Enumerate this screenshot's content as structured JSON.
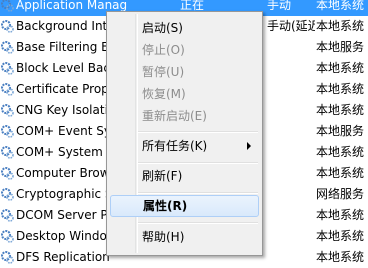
{
  "services": [
    {
      "name": "Application Manag",
      "status": "正在",
      "start": "手动",
      "logon": "本地系统"
    },
    {
      "name": "Background Int",
      "status": "",
      "start": "手动(延迟...",
      "logon": "本地系统"
    },
    {
      "name": "Base Filtering En",
      "status": "",
      "start": "",
      "logon": "本地服务"
    },
    {
      "name": "Block Level Bac",
      "status": "",
      "start": "",
      "logon": "本地系统"
    },
    {
      "name": "Certificate Prop",
      "status": "",
      "start": "",
      "logon": "本地系统"
    },
    {
      "name": "CNG Key Isolati",
      "status": "",
      "start": "",
      "logon": "本地系统"
    },
    {
      "name": "COM+ Event Sy",
      "status": "",
      "start": "",
      "logon": "本地服务"
    },
    {
      "name": "COM+ System A",
      "status": "",
      "start": "",
      "logon": "本地系统"
    },
    {
      "name": "Computer Brow",
      "status": "",
      "start": "",
      "logon": "本地系统"
    },
    {
      "name": "Cryptographic S",
      "status": "",
      "start": "",
      "logon": "网络服务"
    },
    {
      "name": "DCOM Server P",
      "status": "",
      "start": "",
      "logon": "本地系统"
    },
    {
      "name": "Desktop Windo",
      "status": "",
      "start": "",
      "logon": "本地系统"
    },
    {
      "name": "DFS Replication",
      "status": "",
      "start": "",
      "logon": "本地系统"
    }
  ],
  "context_menu": {
    "start": "启动(S)",
    "stop": "停止(O)",
    "pause": "暂停(U)",
    "resume": "恢复(M)",
    "restart": "重新启动(E)",
    "all_tasks": "所有任务(K)",
    "refresh": "刷新(F)",
    "properties": "属性(R)",
    "help": "帮助(H)"
  },
  "colors": {
    "selection": "#3399ff",
    "menu_bg": "#f0f0f0",
    "disabled_text": "#8d8d8d",
    "icon": "#4a7fc1"
  }
}
